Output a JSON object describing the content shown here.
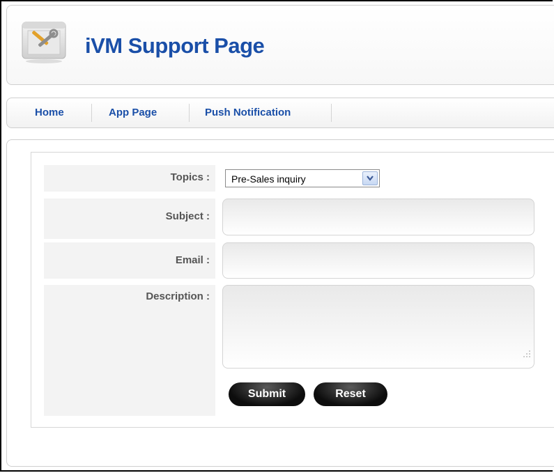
{
  "header": {
    "title": "iVM Support Page",
    "logo_icon": "tools-icon"
  },
  "nav": {
    "items": [
      {
        "label": "Home"
      },
      {
        "label": "App Page"
      },
      {
        "label": "Push Notification"
      }
    ]
  },
  "form": {
    "topics": {
      "label": "Topics :",
      "selected": "Pre-Sales inquiry"
    },
    "subject": {
      "label": "Subject :",
      "value": ""
    },
    "email": {
      "label": "Email :",
      "value": ""
    },
    "description": {
      "label": "Description :",
      "value": ""
    },
    "submit_label": "Submit",
    "reset_label": "Reset"
  },
  "colors": {
    "title": "#1a4fa8",
    "nav_link": "#1a4fa8",
    "label_text": "#555555",
    "label_bg": "#f3f3f3",
    "button_bg": "#111111"
  }
}
